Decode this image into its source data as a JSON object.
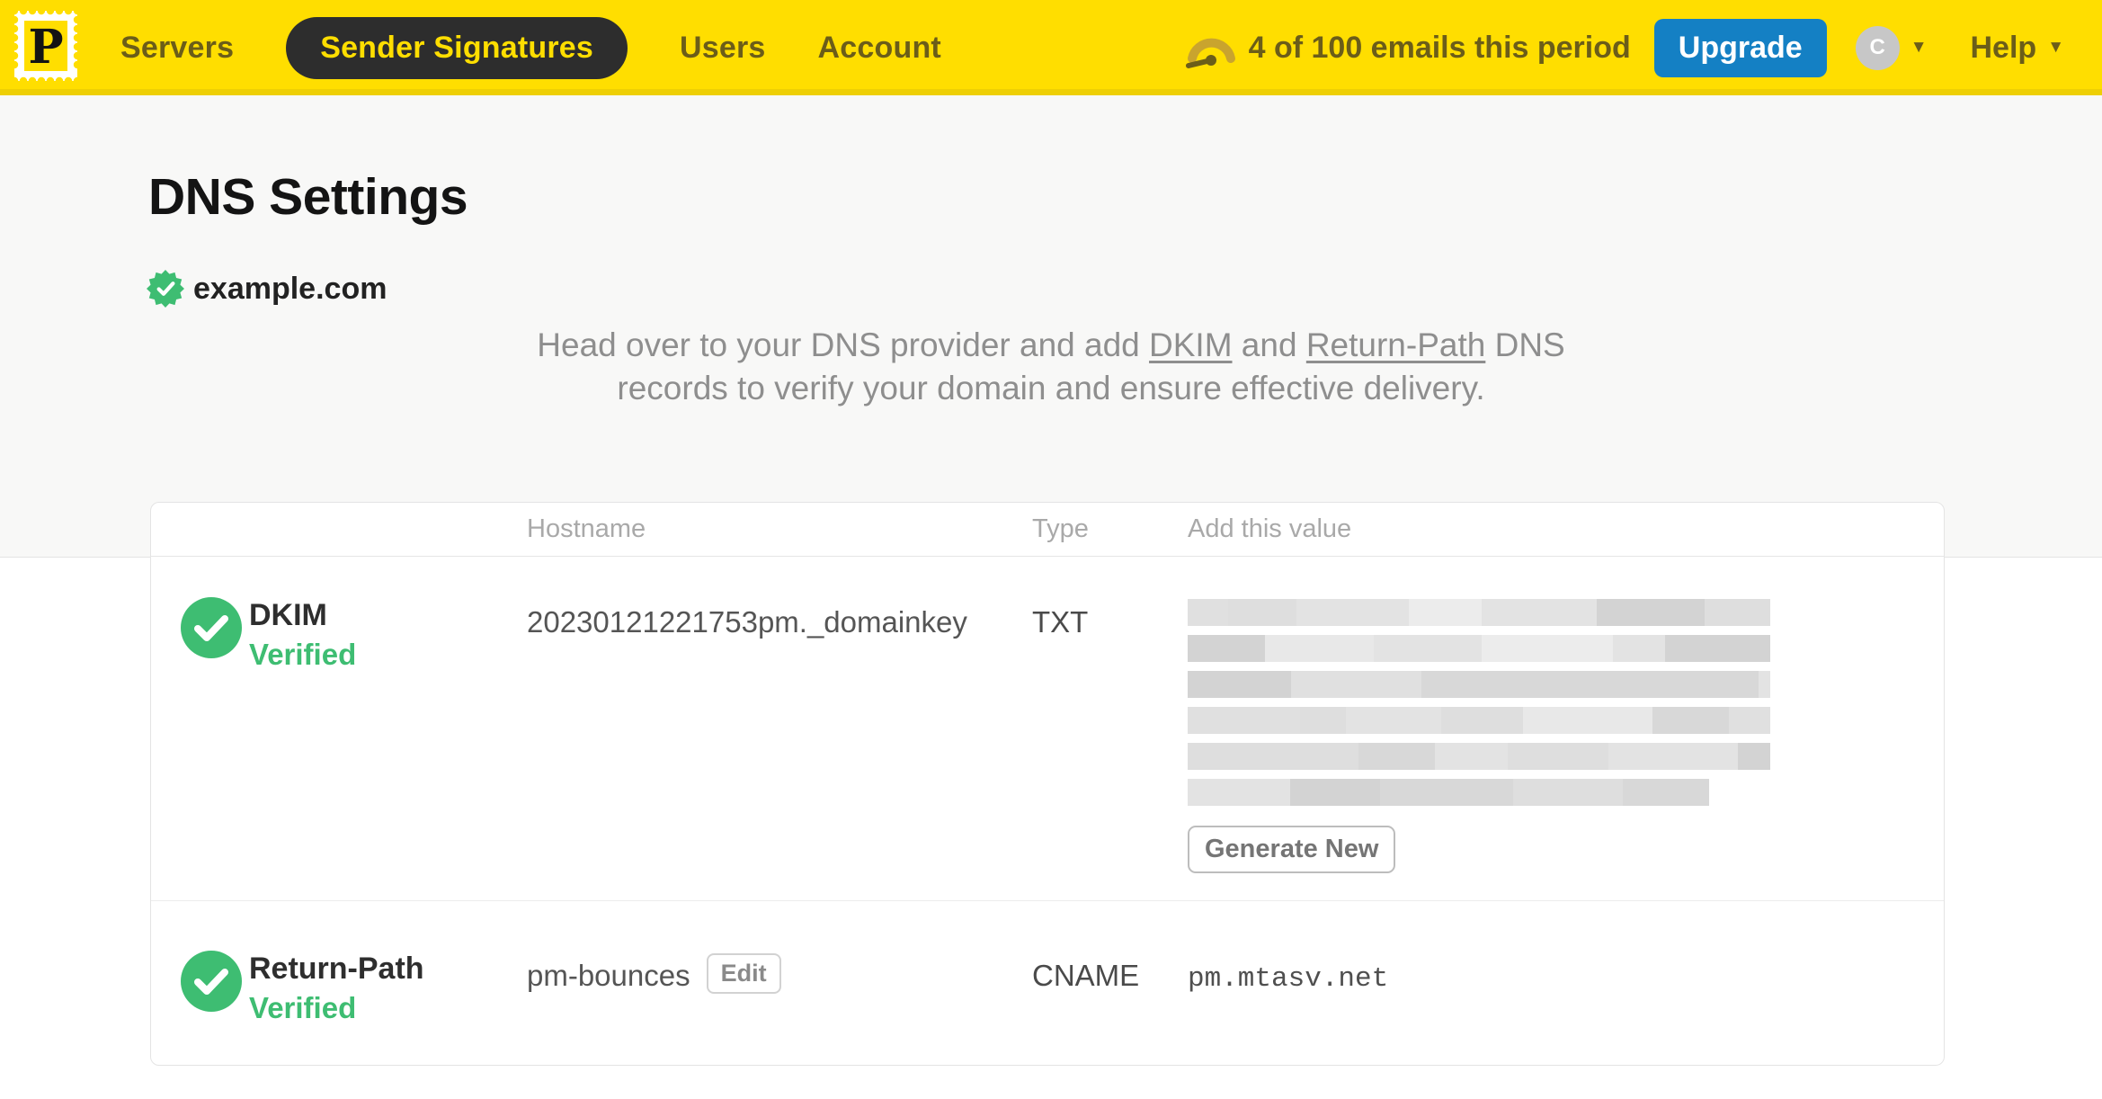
{
  "colors": {
    "brand_yellow": "#ffde00",
    "nav_pill_bg": "#2d2d2d",
    "upgrade_blue": "#1480c4",
    "verified_green": "#3ebd72"
  },
  "nav": {
    "logo_letter": "P",
    "items": [
      {
        "label": "Servers",
        "active": false
      },
      {
        "label": "Sender Signatures",
        "active": true
      },
      {
        "label": "Users",
        "active": false
      },
      {
        "label": "Account",
        "active": false
      }
    ],
    "usage_text": "4 of 100 emails this period",
    "upgrade_label": "Upgrade",
    "account_initial": "C",
    "help_label": "Help",
    "caret_glyph": "▼"
  },
  "page": {
    "title": "DNS Settings",
    "domain": "example.com",
    "intro_segments": [
      {
        "text": "Head over to your DNS provider and add "
      },
      {
        "text": "DKIM",
        "link": true
      },
      {
        "text": " and "
      },
      {
        "text": "Return-Path",
        "link": true
      },
      {
        "text": " DNS records to verify your domain and ensure effective delivery."
      }
    ]
  },
  "table": {
    "headers": {
      "hostname": "Hostname",
      "type": "Type",
      "value": "Add this value"
    },
    "rows": [
      {
        "name": "DKIM",
        "status": "Verified",
        "hostname": "20230121221753pm._domainkey",
        "type": "TXT",
        "value_redacted": true,
        "redacted_rows": [
          648,
          648,
          648,
          648,
          648,
          580
        ],
        "action_label": "Generate New"
      },
      {
        "name": "Return-Path",
        "status": "Verified",
        "hostname": "pm-bounces",
        "edit_label": "Edit",
        "type": "CNAME",
        "value": "pm.mtasv.net"
      }
    ]
  }
}
